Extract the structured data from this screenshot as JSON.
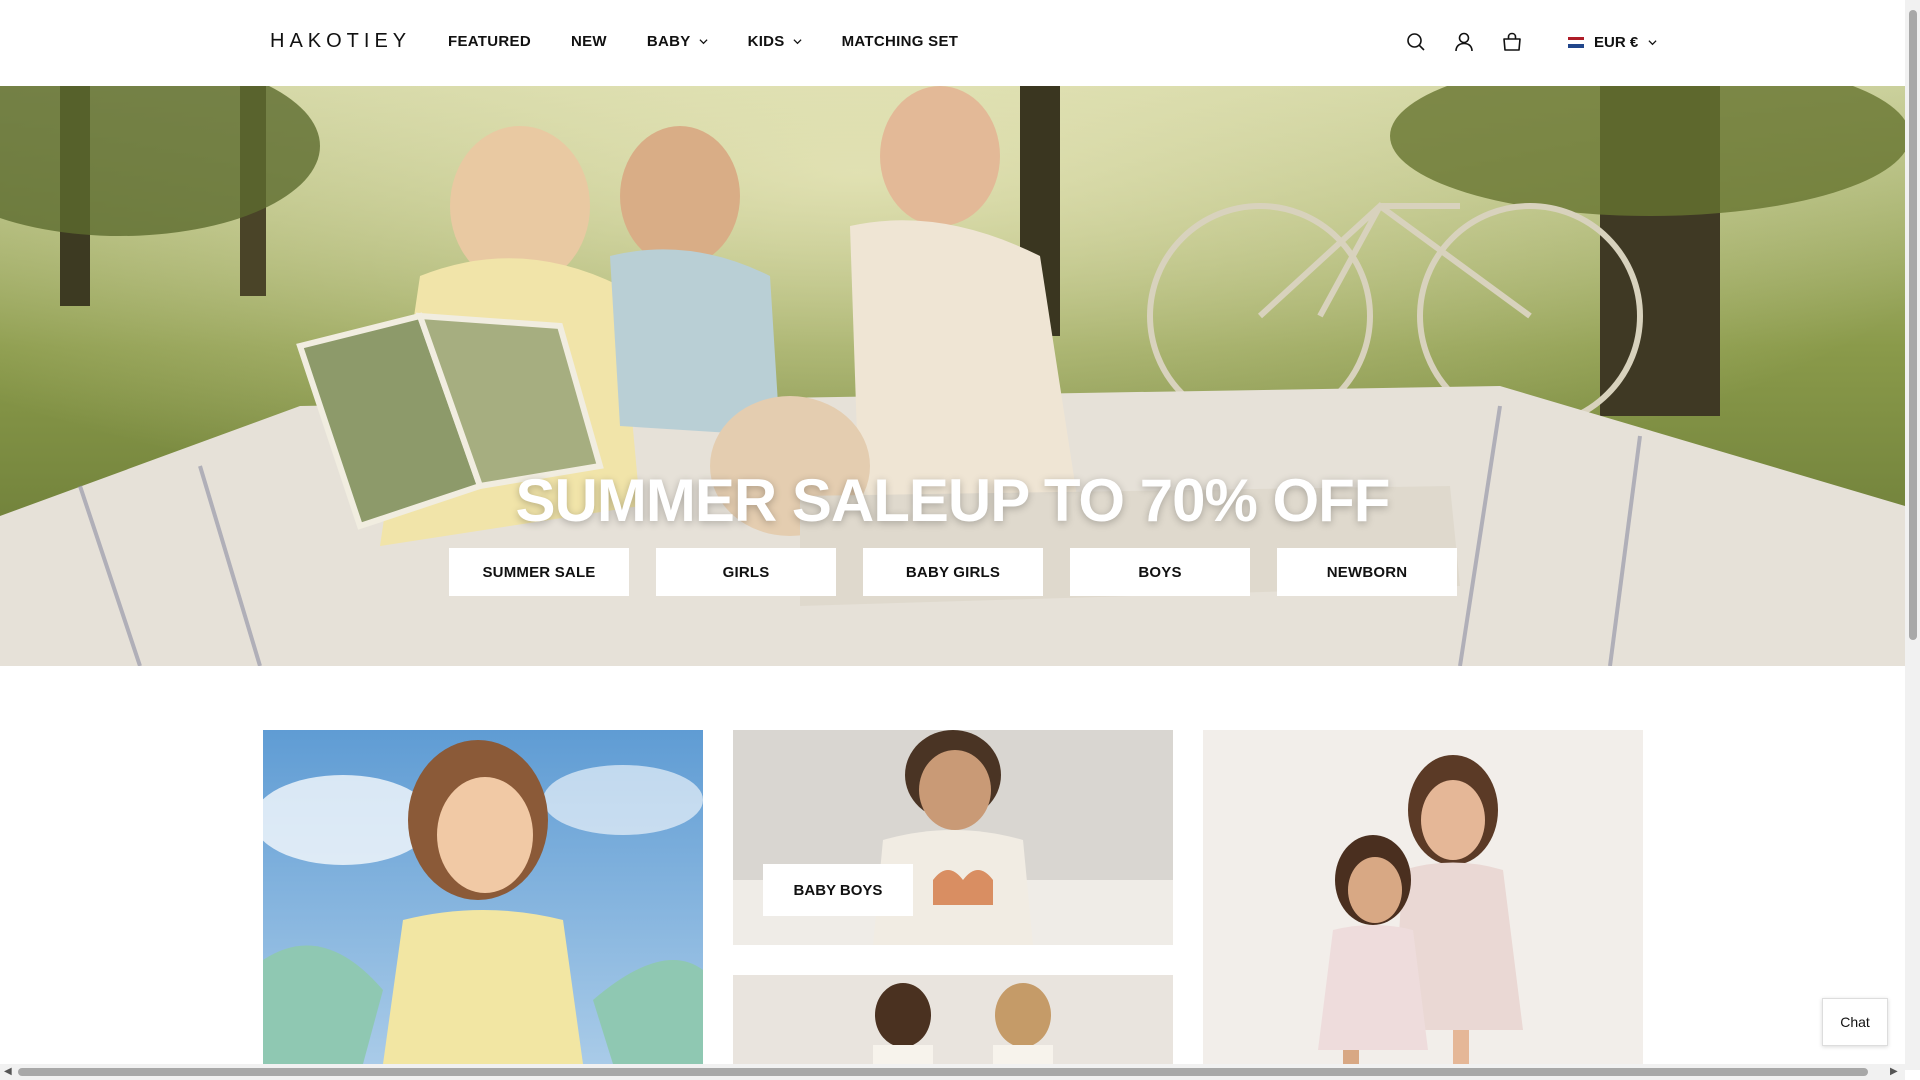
{
  "header": {
    "logo": "HAKOTIEY",
    "nav": [
      {
        "label": "FEATURED",
        "dropdown": false
      },
      {
        "label": "NEW",
        "dropdown": false
      },
      {
        "label": "BABY",
        "dropdown": true
      },
      {
        "label": "KIDS",
        "dropdown": true
      },
      {
        "label": "MATCHING SET",
        "dropdown": false
      }
    ],
    "icons": [
      "search-icon",
      "account-icon",
      "cart-icon"
    ],
    "currency": "EUR €"
  },
  "hero": {
    "title": "SUMMER SALEUP TO 70% OFF",
    "buttons": [
      "SUMMER SALE",
      "GIRLS",
      "BABY GIRLS",
      "BOYS",
      "NEWBORN"
    ]
  },
  "collections": {
    "baby_boys_label": "BABY BOYS"
  },
  "chat": {
    "label": "Chat"
  },
  "colors": {
    "accent": "#111111",
    "background": "#ffffff"
  }
}
